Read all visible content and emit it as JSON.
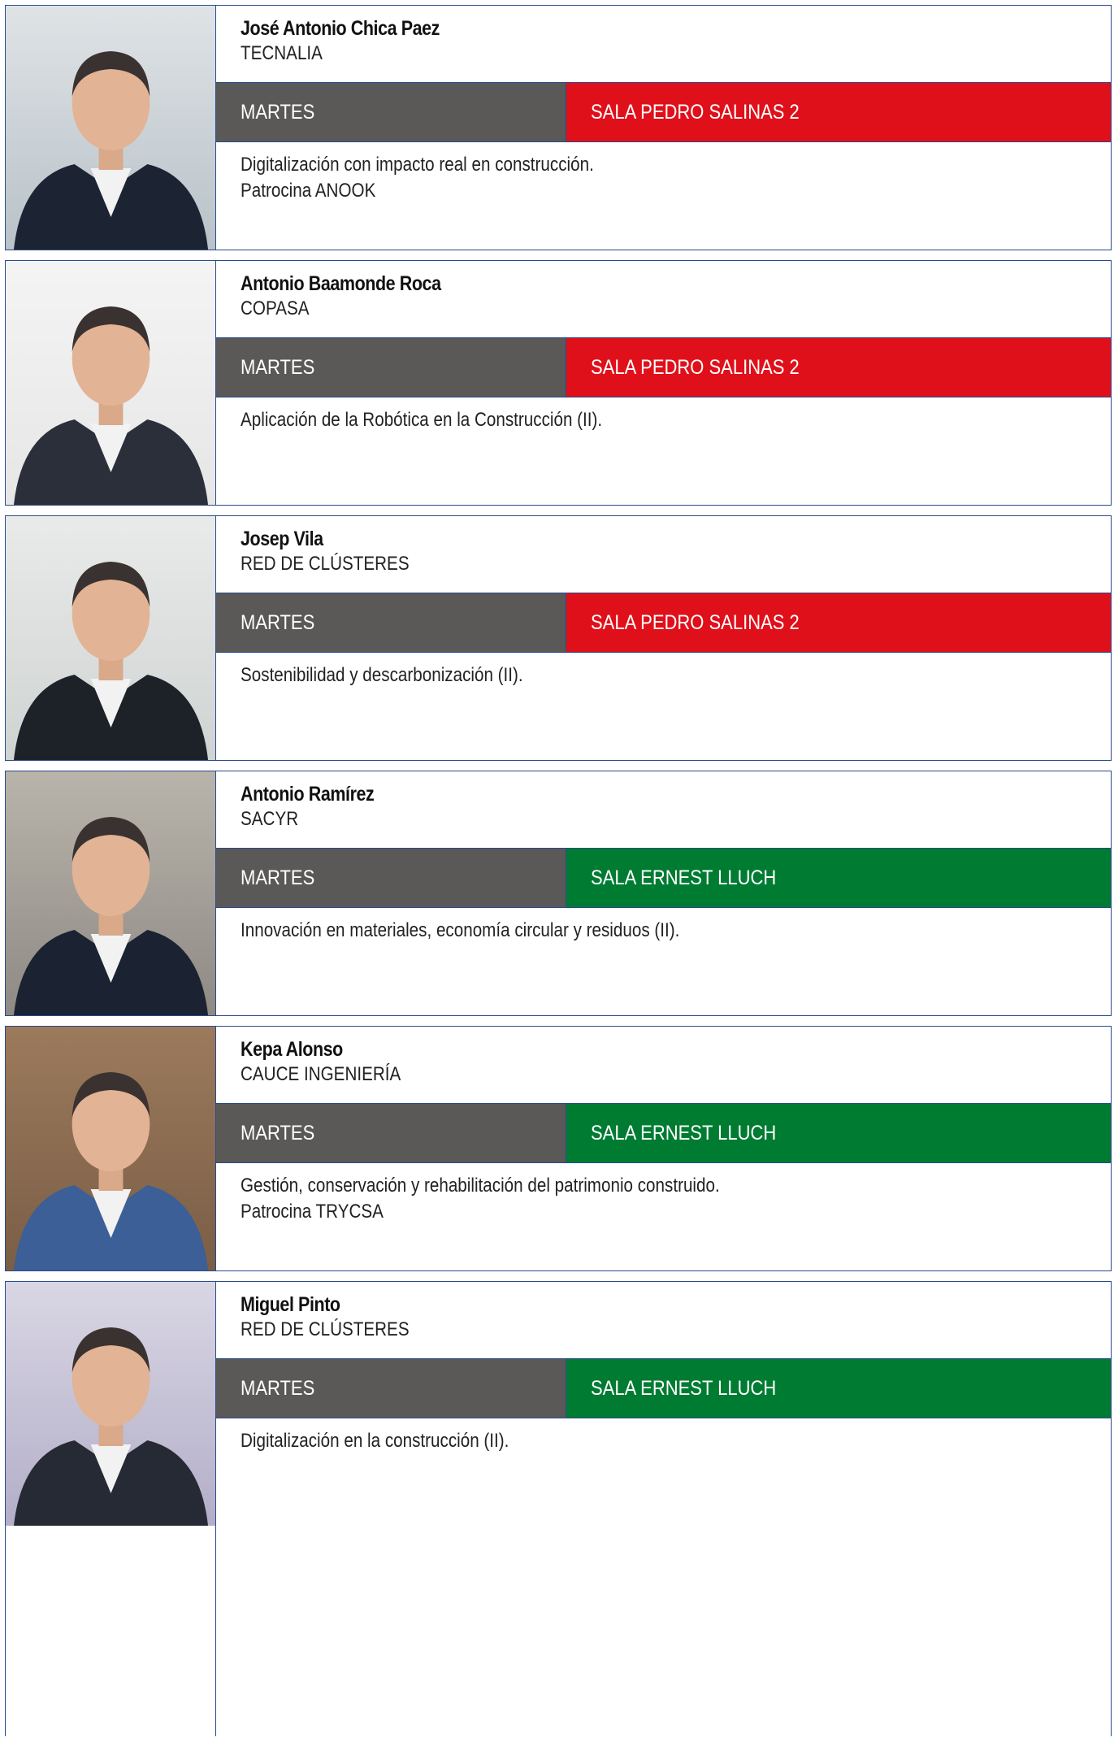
{
  "colors": {
    "border": "#2a4a8c",
    "day_bar": "#5a5958",
    "room_red": "#e0101b",
    "room_green": "#007c32"
  },
  "speakers": [
    {
      "name": "José Antonio Chica Paez",
      "company": "TECNALIA",
      "day": "MARTES",
      "room": "SALA PEDRO SALINAS 2",
      "room_color": "#e0101b",
      "description": "Digitalización con impacto real en construcción.",
      "sponsor": "Patrocina ANOOK",
      "photo": "speaker-photo"
    },
    {
      "name": "Antonio Baamonde Roca",
      "company": "COPASA",
      "day": "MARTES",
      "room": "SALA PEDRO SALINAS 2",
      "room_color": "#e0101b",
      "description": "Aplicación de la Robótica en la Construcción (II).",
      "sponsor": "",
      "photo": "speaker-photo"
    },
    {
      "name": "Josep Vila",
      "company": "RED DE CLÚSTERES",
      "day": "MARTES",
      "room": "SALA PEDRO SALINAS 2",
      "room_color": "#e0101b",
      "description": "Sostenibilidad y descarbonización (II).",
      "sponsor": "",
      "photo": "speaker-photo"
    },
    {
      "name": "Antonio Ramírez",
      "company": "SACYR",
      "day": "MARTES",
      "room": "SALA ERNEST LLUCH",
      "room_color": "#007c32",
      "description": "Innovación en materiales, economía circular y residuos (II).",
      "sponsor": "",
      "photo": "speaker-photo"
    },
    {
      "name": "Kepa Alonso",
      "company": "CAUCE INGENIERÍA",
      "day": "MARTES",
      "room": "SALA ERNEST LLUCH",
      "room_color": "#007c32",
      "description": "Gestión, conservación y rehabilitación del patrimonio construido.",
      "sponsor": "Patrocina TRYCSA",
      "photo": "speaker-photo"
    },
    {
      "name": "Miguel Pinto",
      "company": "RED DE CLÚSTERES",
      "day": "MARTES",
      "room": "SALA ERNEST LLUCH",
      "room_color": "#007c32",
      "description": "Digitalización en la construcción (II).",
      "sponsor": "",
      "photo": "speaker-photo"
    }
  ]
}
